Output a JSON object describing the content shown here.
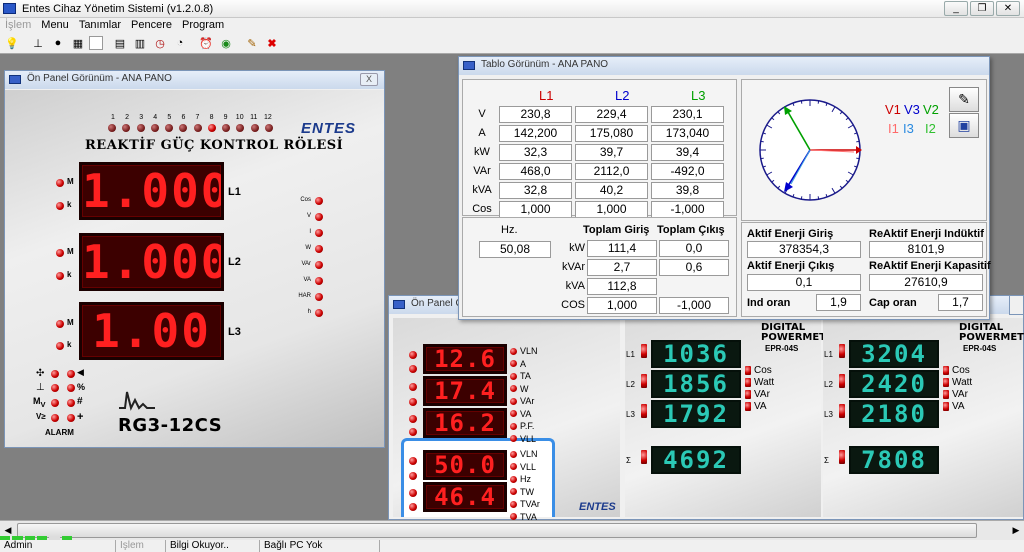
{
  "app": {
    "title": "Entes Cihaz Yönetim Sistemi  (v1.2.0.8)"
  },
  "menu": [
    {
      "label": "İşlem",
      "disabled": true
    },
    {
      "label": "Menu"
    },
    {
      "label": "Tanımlar"
    },
    {
      "label": "Pencere"
    },
    {
      "label": "Program"
    }
  ],
  "toolbar_icons": [
    "bulb-icon",
    "device-icon",
    "plug-icon",
    "grid-icon",
    "blank-icon",
    "calendar-icon",
    "table-icon",
    "clock-icon",
    "gauge-icon",
    "alarm-clock-icon",
    "globe-icon",
    "tools-icon",
    "close-red-icon"
  ],
  "panel1": {
    "title": "Ön Panel Görünüm - ANA PANO",
    "close": "X",
    "led_numbers": [
      "1",
      "2",
      "3",
      "4",
      "5",
      "6",
      "7",
      "8",
      "9",
      "10",
      "11",
      "12"
    ],
    "heading": "REAKTİF GÜÇ KONTROL RÖLESİ",
    "brand": "ENTES",
    "rows": [
      {
        "label": "L1",
        "value": "1.000",
        "m": "M",
        "k": "k"
      },
      {
        "label": "L2",
        "value": "1.000",
        "m": "M",
        "k": "k"
      },
      {
        "label": "L3",
        "value": "1.00",
        "m": "M",
        "k": "k"
      }
    ],
    "right_labels": [
      "Cos",
      "V",
      "I",
      "W",
      "VAr",
      "VA",
      "HAR",
      "h"
    ],
    "bottom_labels": [
      "%",
      "#",
      "+"
    ],
    "alarm": "ALARM",
    "model": "RG3-12CS"
  },
  "table": {
    "title": "Tablo Görünüm - ANA PANO",
    "phases": [
      "L1",
      "L2",
      "L3"
    ],
    "phase_colors": [
      "#cc0000",
      "#0000cc",
      "#00a000"
    ],
    "rows": [
      {
        "label": "V",
        "values": [
          "230,8",
          "229,4",
          "230,1"
        ]
      },
      {
        "label": "A",
        "values": [
          "142,200",
          "175,080",
          "173,040"
        ]
      },
      {
        "label": "kW",
        "values": [
          "32,3",
          "39,7",
          "39,4"
        ]
      },
      {
        "label": "VAr",
        "values": [
          "468,0",
          "2112,0",
          "-492,0"
        ]
      },
      {
        "label": "kVA",
        "values": [
          "32,8",
          "40,2",
          "39,8"
        ]
      },
      {
        "label": "Cos",
        "values": [
          "1,000",
          "1,000",
          "-1,000"
        ]
      }
    ],
    "hz_label": "Hz.",
    "hz_value": "50,08",
    "totals_headers": [
      "Toplam Giriş",
      "Toplam Çıkış"
    ],
    "totals": [
      {
        "label": "kW",
        "in": "111,4",
        "out": "0,0"
      },
      {
        "label": "kVAr",
        "in": "2,7",
        "out": "0,6"
      },
      {
        "label": "kVA",
        "in": "112,8",
        "out": ""
      },
      {
        "label": "COS",
        "in": "1,000",
        "out": "-1,000"
      }
    ],
    "legend": {
      "v1": "V1",
      "v3": "V3",
      "v2": "V2",
      "i1": "I1",
      "i3": "I3",
      "i2": "I2"
    },
    "energy": {
      "aktif_giris_label": "Aktif Enerji Giriş",
      "aktif_giris": "378354,3",
      "reaktif_ind_label": "ReAktif Enerji Indüktif",
      "reaktif_ind": "8101,9",
      "aktif_cikis_label": "Aktif Enerji Çıkış",
      "aktif_cikis": "0,1",
      "reaktif_kap_label": "ReAktif Enerji Kapasitif",
      "reaktif_kap": "27610,9",
      "ind_oran_label": "Ind oran",
      "ind_oran": "1,9",
      "cap_oran_label": "Cap oran",
      "cap_oran": "1,7"
    }
  },
  "panel2": {
    "title": "Ön Panel Görünüm",
    "displays": [
      "12.6",
      "17.4",
      "16.2",
      "50.0",
      "46.4"
    ],
    "labels_a": [
      "VLN",
      "A",
      "TA",
      "W",
      "VAr",
      "VA",
      "P.F.",
      "VLL"
    ],
    "labels_b": [
      "VLN",
      "VLL",
      "Hz",
      "TW",
      "TVAr",
      "TVA"
    ]
  },
  "meter1": {
    "brand": "DIGITAL",
    "brand2": "POWERMETER",
    "model": "EPR-04S",
    "values": [
      "1036",
      "1856",
      "1792",
      "4692"
    ],
    "labels": [
      "Cos",
      "Watt",
      "VAr",
      "VA"
    ],
    "lines": [
      "L1",
      "L2",
      "L3",
      "Σ"
    ]
  },
  "meter2": {
    "brand": "DIGITAL",
    "brand2": "POWERMETER",
    "model": "EPR-04S",
    "values": [
      "3204",
      "2420",
      "2180",
      "7808"
    ],
    "labels": [
      "Cos",
      "Watt",
      "VAr",
      "VA"
    ],
    "lines": [
      "L1",
      "L2",
      "L3",
      "Σ"
    ]
  },
  "status": [
    "Admin",
    "İşlem",
    "Bilgi Okuyor..",
    "Bağlı PC Yok"
  ]
}
